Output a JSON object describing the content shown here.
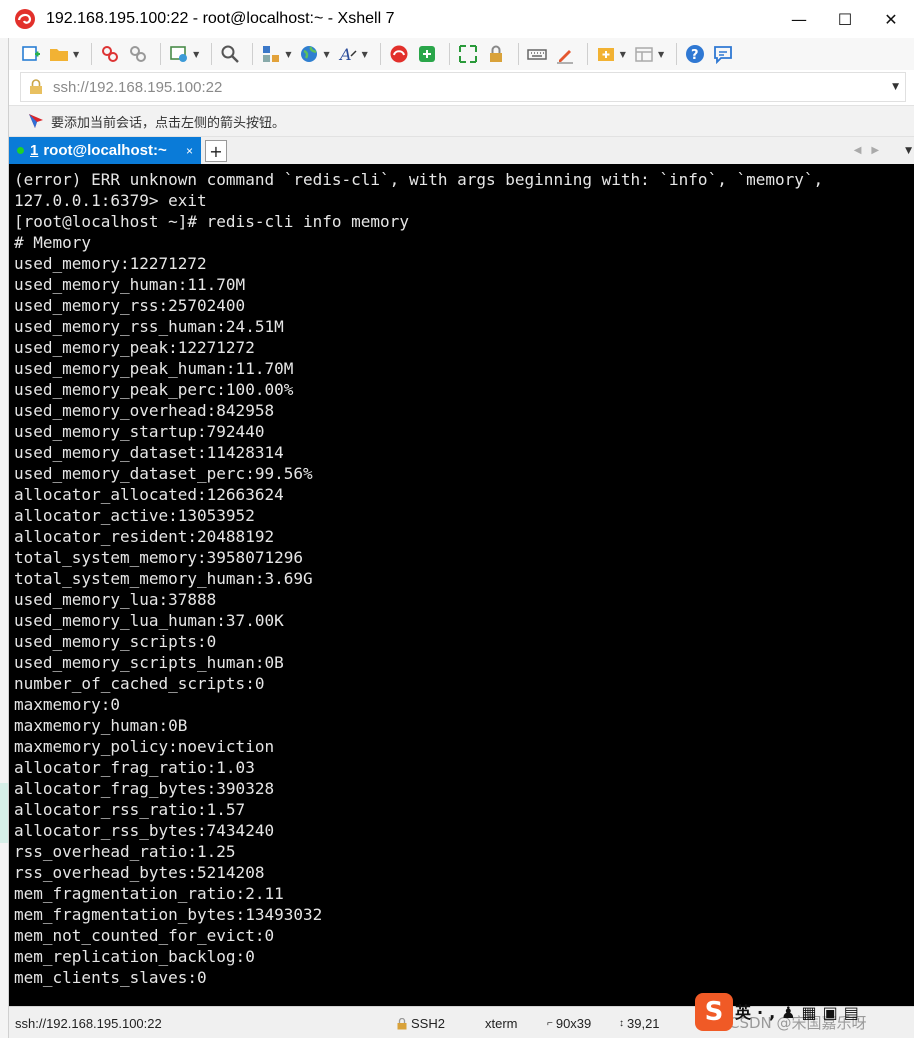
{
  "window": {
    "title": "192.168.195.100:22 - root@localhost:~ - Xshell 7",
    "minimize": "—",
    "maximize": "☐",
    "close": "✕"
  },
  "address": {
    "value": "ssh://192.168.195.100:22"
  },
  "session_hint": "要添加当前会话，点击左侧的箭头按钮。",
  "tab": {
    "number": "1",
    "label": "root@localhost:~",
    "close": "×",
    "add": "+"
  },
  "terminal": {
    "lines": [
      "(error) ERR unknown command `redis-cli`, with args beginning with: `info`, `memory`,",
      "127.0.0.1:6379> exit",
      "[root@localhost ~]# redis-cli info memory",
      "# Memory",
      "used_memory:12271272",
      "used_memory_human:11.70M",
      "used_memory_rss:25702400",
      "used_memory_rss_human:24.51M",
      "used_memory_peak:12271272",
      "used_memory_peak_human:11.70M",
      "used_memory_peak_perc:100.00%",
      "used_memory_overhead:842958",
      "used_memory_startup:792440",
      "used_memory_dataset:11428314",
      "used_memory_dataset_perc:99.56%",
      "allocator_allocated:12663624",
      "allocator_active:13053952",
      "allocator_resident:20488192",
      "total_system_memory:3958071296",
      "total_system_memory_human:3.69G",
      "used_memory_lua:37888",
      "used_memory_lua_human:37.00K",
      "used_memory_scripts:0",
      "used_memory_scripts_human:0B",
      "number_of_cached_scripts:0",
      "maxmemory:0",
      "maxmemory_human:0B",
      "maxmemory_policy:noeviction",
      "allocator_frag_ratio:1.03",
      "allocator_frag_bytes:390328",
      "allocator_rss_ratio:1.57",
      "allocator_rss_bytes:7434240",
      "rss_overhead_ratio:1.25",
      "rss_overhead_bytes:5214208",
      "mem_fragmentation_ratio:2.11",
      "mem_fragmentation_bytes:13493032",
      "mem_not_counted_for_evict:0",
      "mem_replication_backlog:0",
      "mem_clients_slaves:0"
    ]
  },
  "status": {
    "connection": "ssh://192.168.195.100:22",
    "protocol": "SSH2",
    "terminal_type": "xterm",
    "size": "90x39",
    "cursor": "39,21",
    "watermark": "CSDN @宋国嘉乐呀",
    "ime_label": "英"
  },
  "colors": {
    "tab_active": "#0a7bd8",
    "terminal_bg": "#000000",
    "terminal_fg": "#e6e6e6",
    "status_dot": "#1fd12a"
  },
  "icons": [
    "xshell-app-icon",
    "new-session-icon",
    "open-folder-icon",
    "disconnect-icon",
    "reconnect-icon",
    "properties-icon",
    "find-icon",
    "transfer-icon",
    "globe-icon",
    "font-icon",
    "xshell-icon",
    "xftp-icon",
    "fullscreen-icon",
    "lock-icon",
    "keyboard-icon",
    "highlight-icon",
    "add-tab-icon",
    "layout-icon",
    "help-icon",
    "chat-icon"
  ]
}
